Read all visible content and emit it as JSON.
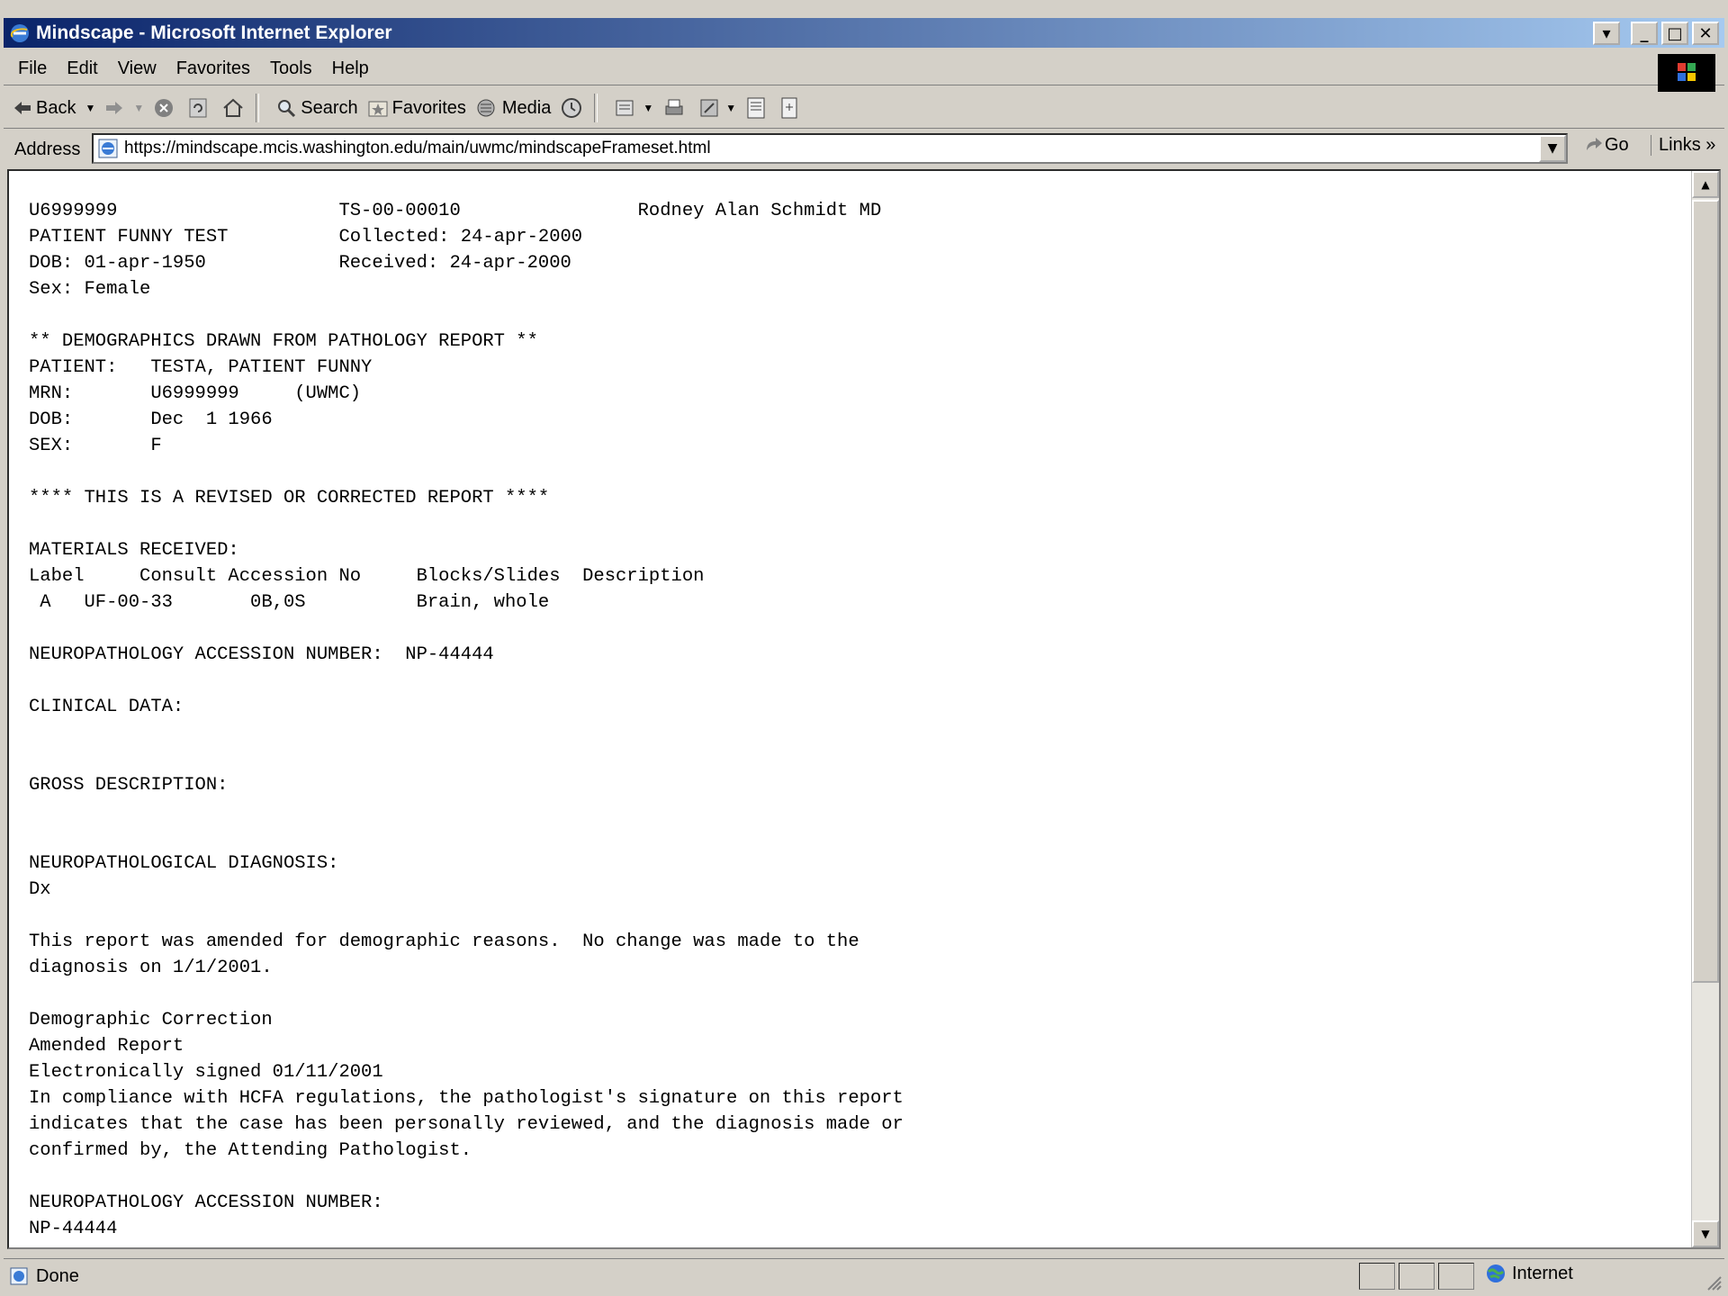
{
  "window": {
    "title": "Mindscape - Microsoft Internet Explorer"
  },
  "menu": {
    "items": [
      "File",
      "Edit",
      "View",
      "Favorites",
      "Tools",
      "Help"
    ]
  },
  "toolbar": {
    "back": "Back",
    "search": "Search",
    "favorites": "Favorites",
    "media": "Media"
  },
  "address": {
    "label": "Address",
    "url": "https://mindscape.mcis.washington.edu/main/uwmc/mindscapeFrameset.html",
    "go": "Go",
    "links": "Links"
  },
  "report": {
    "text": "U6999999                    TS-00-00010                Rodney Alan Schmidt MD\nPATIENT FUNNY TEST          Collected: 24-apr-2000\nDOB: 01-apr-1950            Received: 24-apr-2000\nSex: Female\n\n** DEMOGRAPHICS DRAWN FROM PATHOLOGY REPORT **\nPATIENT:   TESTA, PATIENT FUNNY\nMRN:       U6999999     (UWMC)\nDOB:       Dec  1 1966\nSEX:       F\n\n**** THIS IS A REVISED OR CORRECTED REPORT ****\n\nMATERIALS RECEIVED:\nLabel     Consult Accession No     Blocks/Slides  Description\n A   UF-00-33       0B,0S          Brain, whole\n\nNEUROPATHOLOGY ACCESSION NUMBER:  NP-44444\n\nCLINICAL DATA:\n\n\nGROSS DESCRIPTION:\n\n\nNEUROPATHOLOGICAL DIAGNOSIS:\nDx\n\nThis report was amended for demographic reasons.  No change was made to the\ndiagnosis on 1/1/2001.\n\nDemographic Correction\nAmended Report\nElectronically signed 01/11/2001\nIn compliance with HCFA regulations, the pathologist's signature on this report\nindicates that the case has been personally reviewed, and the diagnosis made or\nconfirmed by, the Attending Pathologist.\n\nNEUROPATHOLOGY ACCESSION NUMBER:\nNP-44444"
  },
  "status": {
    "text": "Done",
    "zone": "Internet"
  }
}
